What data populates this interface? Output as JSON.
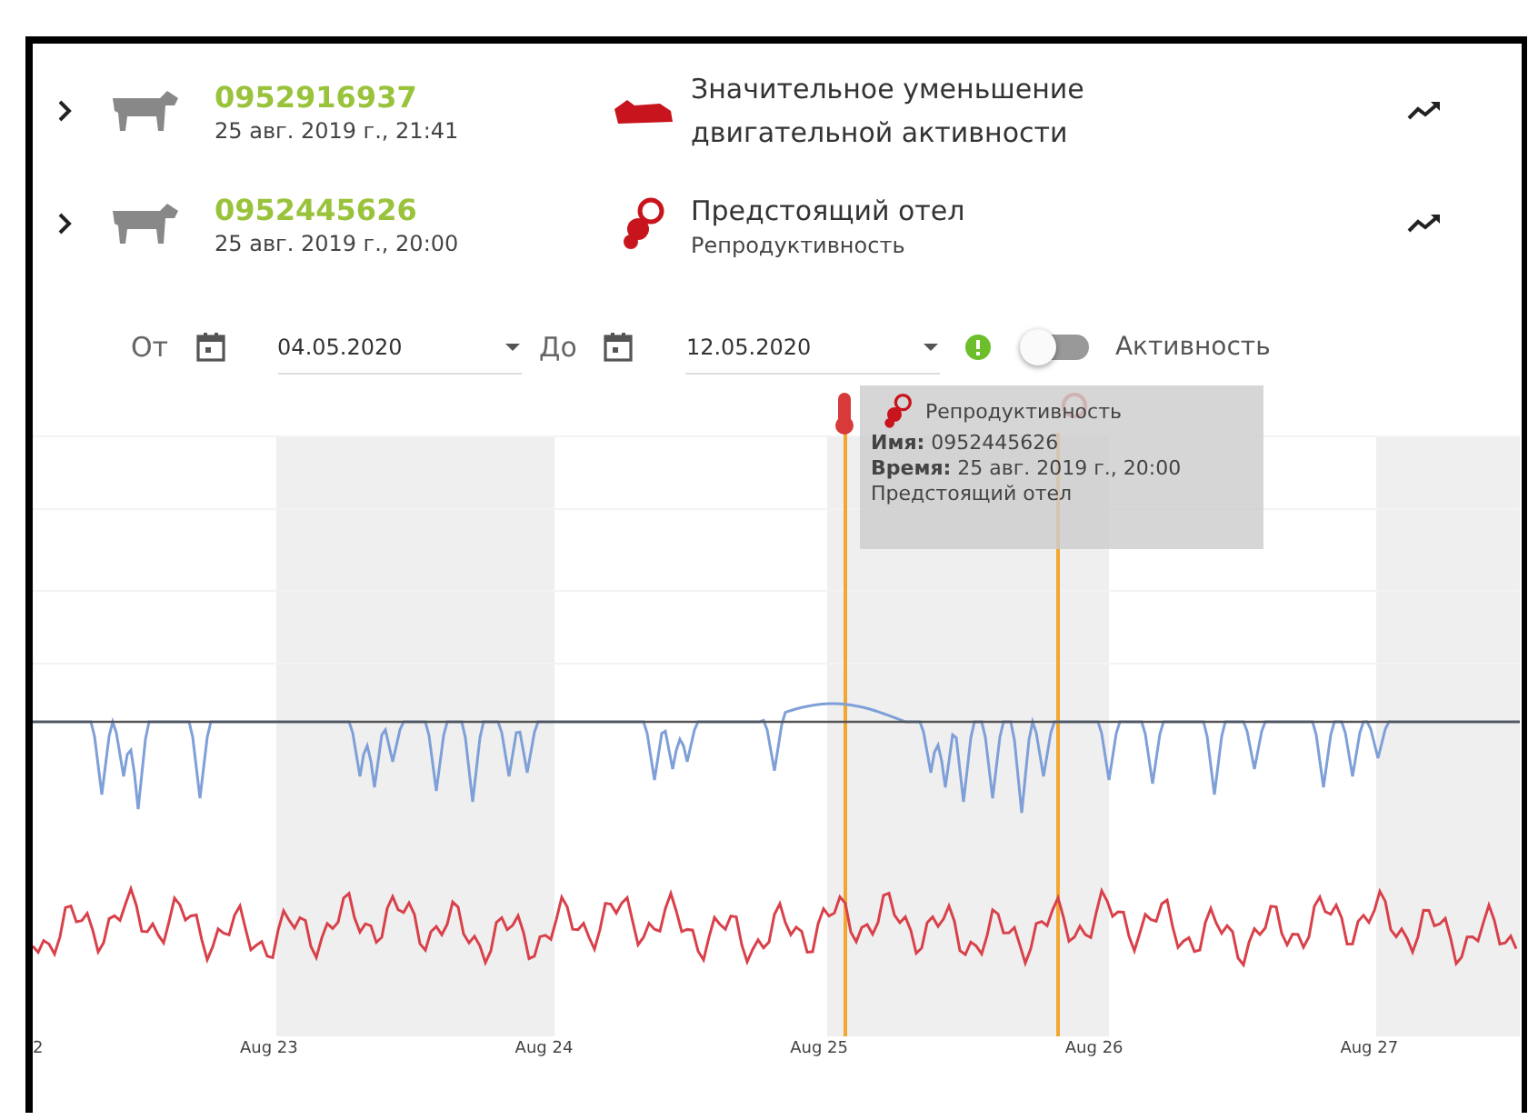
{
  "records": [
    {
      "expanded": false,
      "id": "0952916937",
      "time": "25 авг. 2019 г., 21:41",
      "kind": "activity",
      "event": "Значительное уменьшение двигательной активности"
    },
    {
      "expanded": false,
      "id": "0952445626",
      "time": "25 авг. 2019 г., 20:00",
      "kind": "reproduction",
      "event": "Предстоящий отел",
      "category": "Репродуктивность"
    }
  ],
  "filter": {
    "from_label": "От",
    "from": "04.05.2020",
    "to_label": "До",
    "to": "12.05.2020",
    "activity_toggle": {
      "label": "Активность",
      "on": false
    }
  },
  "chart": {
    "x_labels": [
      "2",
      "Aug 23",
      "Aug 24",
      "Aug 25",
      "Aug 26",
      "Aug 27"
    ],
    "tooltip": {
      "category": "Репродуктивность",
      "name": "**Имя:** 0952445626",
      "time": "**Время:** 25 авг. 2019 г., 20:00",
      "event": "Предстоящий отел"
    }
  }
}
